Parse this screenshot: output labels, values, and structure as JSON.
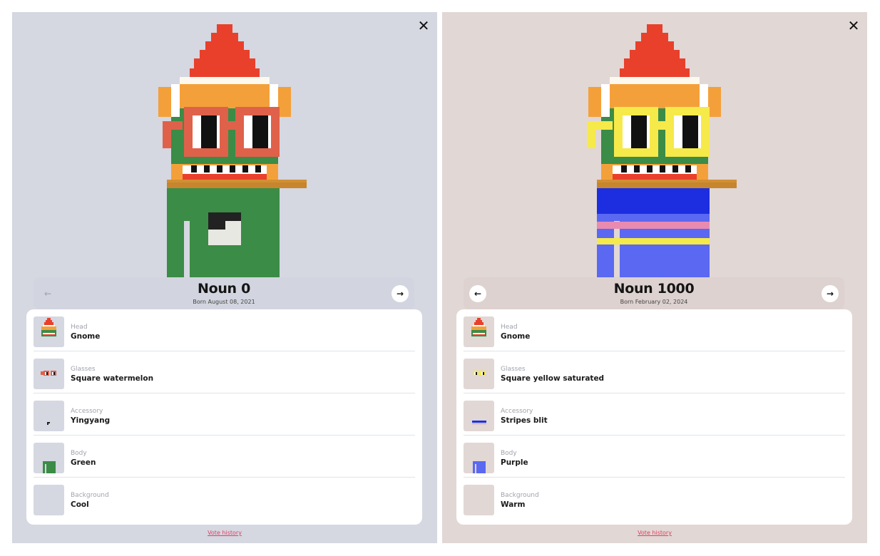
{
  "panels": [
    {
      "title": "Noun 0",
      "born": "Born August 08, 2021",
      "prev_icon": "←",
      "next_icon": "→",
      "close_icon": "✕",
      "traits": [
        {
          "label": "Head",
          "value": "Gnome"
        },
        {
          "label": "Glasses",
          "value": "Square watermelon"
        },
        {
          "label": "Accessory",
          "value": "Yingyang"
        },
        {
          "label": "Body",
          "value": "Green"
        },
        {
          "label": "Background",
          "value": "Cool"
        }
      ],
      "vote_history": "Vote history",
      "colors": {
        "background": "#d5d7e1",
        "body": "#3d8c47",
        "glasses": "#e0614a"
      }
    },
    {
      "title": "Noun 1000",
      "born": "Born February 02, 2024",
      "prev_icon": "←",
      "next_icon": "→",
      "close_icon": "✕",
      "traits": [
        {
          "label": "Head",
          "value": "Gnome"
        },
        {
          "label": "Glasses",
          "value": "Square yellow saturated"
        },
        {
          "label": "Accessory",
          "value": "Stripes blit"
        },
        {
          "label": "Body",
          "value": "Purple"
        },
        {
          "label": "Background",
          "value": "Warm"
        }
      ],
      "vote_history": "Vote history",
      "colors": {
        "background": "#e1d7d5",
        "body": "#5b68f2",
        "glasses": "#f6e94a"
      }
    }
  ]
}
